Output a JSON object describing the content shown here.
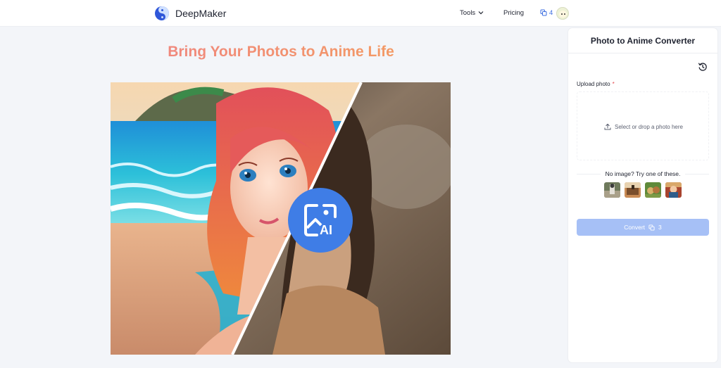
{
  "header": {
    "brand": "DeepMaker",
    "nav": {
      "tools_label": "Tools",
      "pricing_label": "Pricing"
    },
    "credits_count": "4"
  },
  "main": {
    "headline": "Bring Your Photos to Anime Life"
  },
  "panel": {
    "title": "Photo to Anime Converter",
    "upload_label": "Upload photo",
    "required_mark": "*",
    "dropzone_text": "Select or drop a photo here",
    "samples_prompt": "No image? Try one of these.",
    "convert_label": "Convert",
    "convert_cost": "3"
  },
  "icons": [
    "logo-icon",
    "chevron-down-icon",
    "credits-icon",
    "avatar",
    "history-icon",
    "upload-icon",
    "ai-image-icon"
  ],
  "colors": {
    "accent": "#3b6de0",
    "convert_button": "#a6c0f6",
    "headline_gradient": [
      "#ec7b8d",
      "#f4a654"
    ]
  }
}
